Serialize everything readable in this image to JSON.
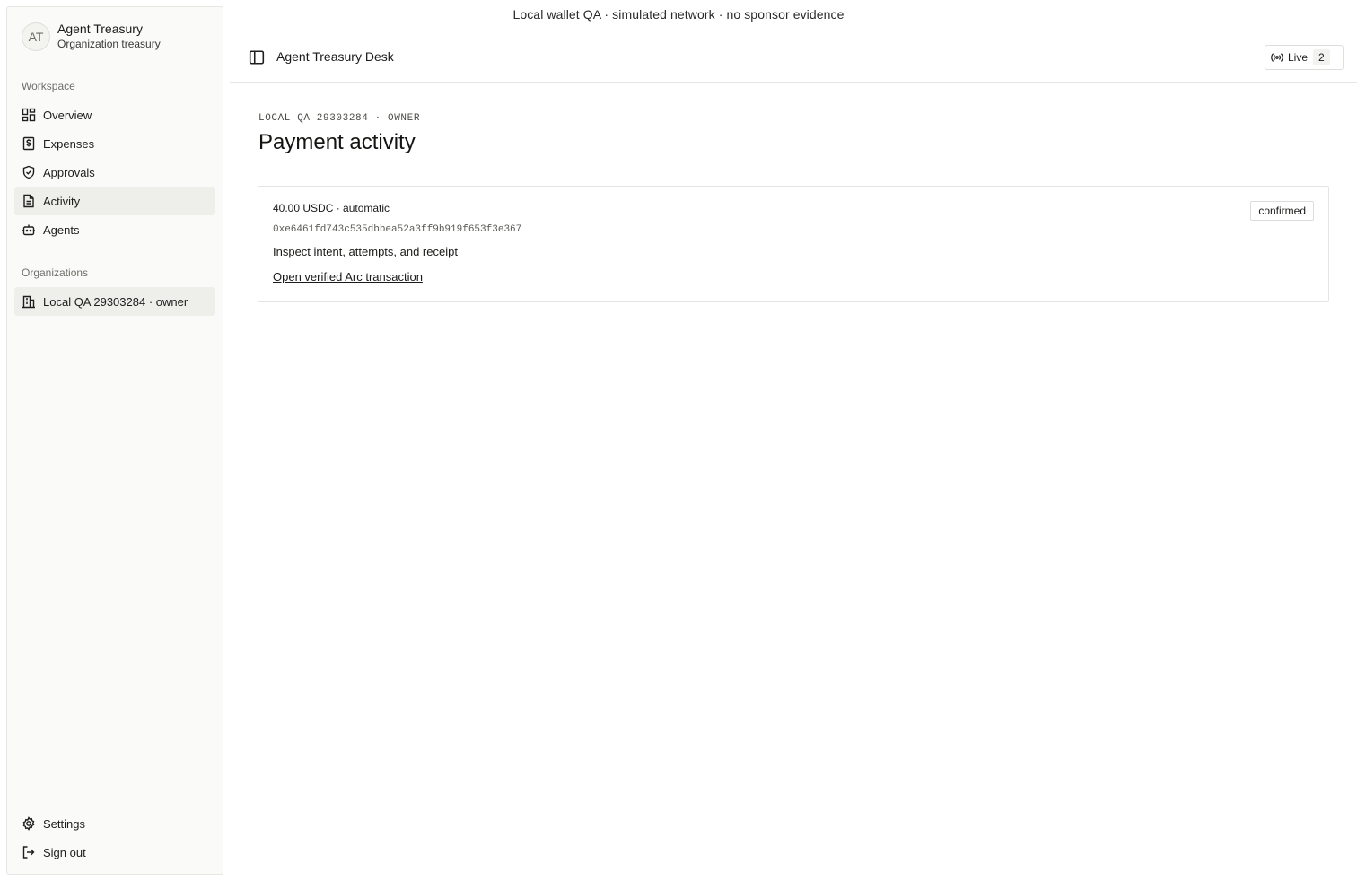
{
  "banner": "Local wallet QA · simulated network · no sponsor evidence",
  "brand": {
    "initials": "AT",
    "title": "Agent Treasury",
    "subtitle": "Organization treasury"
  },
  "sidebar": {
    "workspace_label": "Workspace",
    "items": [
      {
        "label": "Overview",
        "icon": "dashboard-icon",
        "active": false
      },
      {
        "label": "Expenses",
        "icon": "receipt-dollar-icon",
        "active": false
      },
      {
        "label": "Approvals",
        "icon": "shield-check-icon",
        "active": false
      },
      {
        "label": "Activity",
        "icon": "document-icon",
        "active": true
      },
      {
        "label": "Agents",
        "icon": "bot-icon",
        "active": false
      }
    ],
    "organizations_label": "Organizations",
    "org_item": {
      "label": "Local QA 29303284 · owner",
      "icon": "building-icon"
    },
    "footer": [
      {
        "label": "Settings",
        "icon": "gear-icon"
      },
      {
        "label": "Sign out",
        "icon": "sign-out-icon"
      }
    ]
  },
  "header": {
    "title": "Agent Treasury Desk",
    "live_label": "Live",
    "live_count": "2"
  },
  "main": {
    "eyebrow": "LOCAL QA 29303284 · OWNER",
    "title": "Payment activity",
    "payment": {
      "amount": "40.00 USDC · automatic",
      "hash": "0xe6461fd743c535dbbea52a3ff9b919f653f3e367",
      "inspect_link": "Inspect intent, attempts, and receipt",
      "arc_link": "Open verified Arc transaction",
      "status": "confirmed"
    }
  }
}
